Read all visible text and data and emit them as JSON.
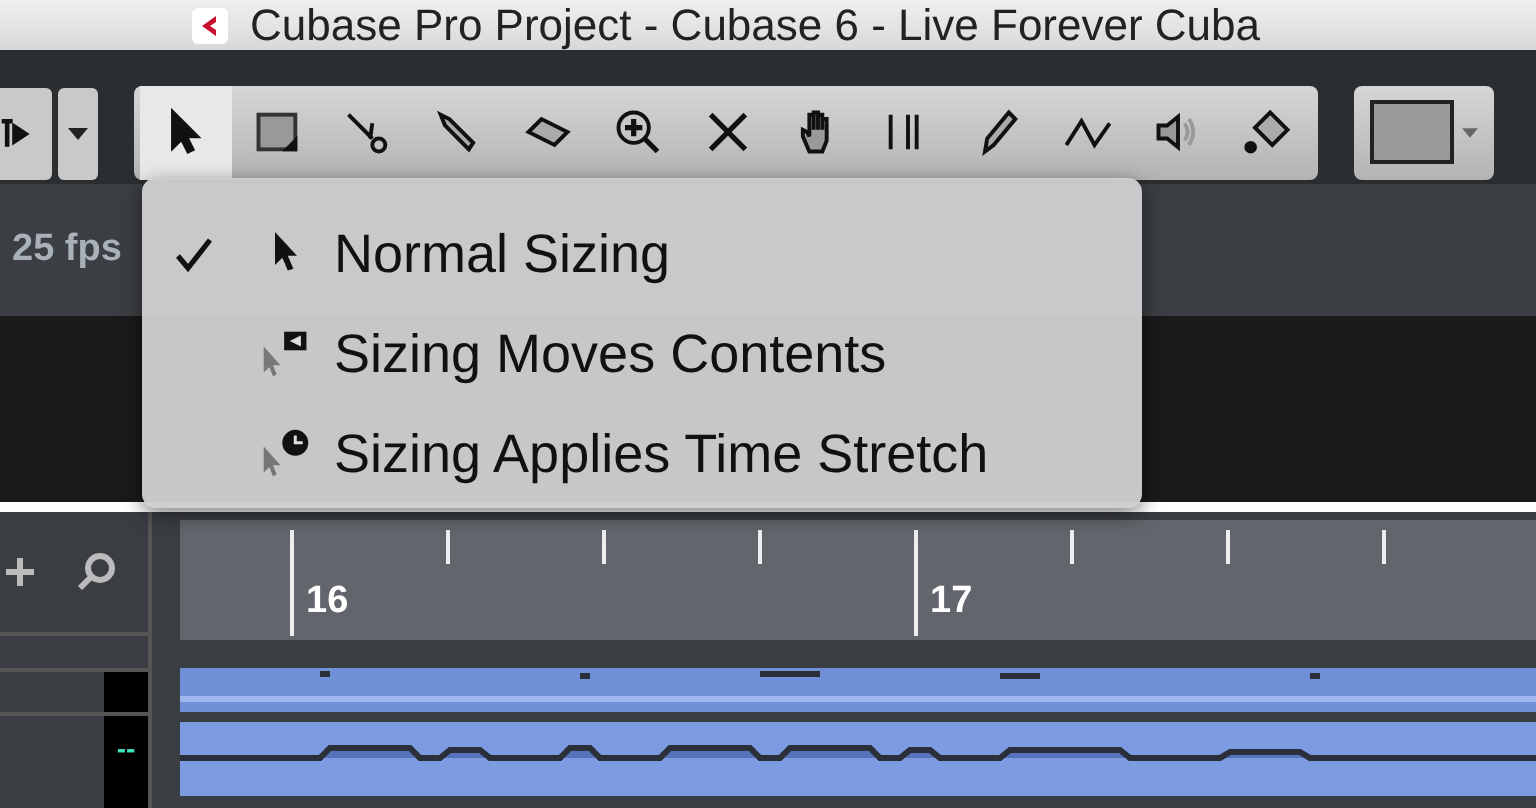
{
  "window": {
    "title": "Cubase Pro Project - Cubase 6 - Live Forever Cuba"
  },
  "toolbar": {
    "tools": [
      {
        "kind": "pointer",
        "selected": true
      },
      {
        "kind": "range",
        "selected": false
      },
      {
        "kind": "scissors",
        "selected": false
      },
      {
        "kind": "glue",
        "selected": false
      },
      {
        "kind": "eraser",
        "selected": false
      },
      {
        "kind": "zoom",
        "selected": false
      },
      {
        "kind": "mute",
        "selected": false
      },
      {
        "kind": "hand",
        "selected": false
      },
      {
        "kind": "split",
        "selected": false
      },
      {
        "kind": "pencil",
        "selected": false
      },
      {
        "kind": "line",
        "selected": false
      },
      {
        "kind": "speaker",
        "selected": false
      },
      {
        "kind": "bucket",
        "selected": false
      }
    ]
  },
  "info_line": {
    "frame_rate": "25 fps"
  },
  "sizing_menu": {
    "items": [
      {
        "label": "Normal Sizing",
        "kind": "normal",
        "checked": true,
        "selected": false
      },
      {
        "label": "Sizing Moves Contents",
        "kind": "moves",
        "checked": false,
        "selected": false
      },
      {
        "label": "Sizing Applies Time Stretch",
        "kind": "stretch",
        "checked": false,
        "selected": false
      }
    ]
  },
  "ruler": {
    "bars": [
      "16",
      "17"
    ]
  },
  "track": {
    "meter_text": "--"
  }
}
